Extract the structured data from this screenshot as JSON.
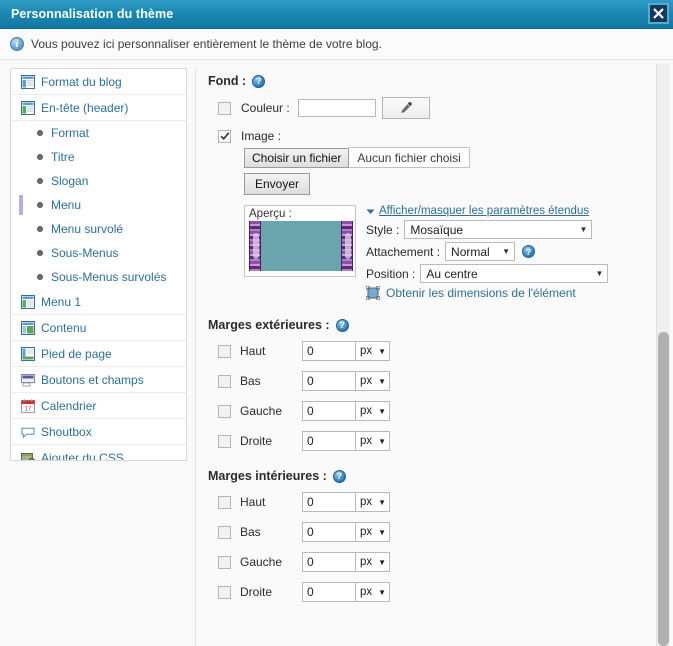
{
  "window": {
    "title": "Personnalisation du thème",
    "close_label": "×"
  },
  "info": {
    "icon": "info-icon",
    "message": "Vous pouvez ici personnaliser entièrement le thème de votre blog."
  },
  "sidebar": {
    "items": [
      {
        "label": "Format du blog",
        "icon": "layout-icon",
        "type": "top"
      },
      {
        "label": "En-tête (header)",
        "icon": "layout-icon",
        "type": "top"
      },
      {
        "label": "Format",
        "icon": "bullet-icon",
        "type": "sub",
        "selected": false
      },
      {
        "label": "Titre",
        "icon": "bullet-icon",
        "type": "sub",
        "selected": false
      },
      {
        "label": "Slogan",
        "icon": "bullet-icon",
        "type": "sub",
        "selected": false
      },
      {
        "label": "Menu",
        "icon": "bullet-icon",
        "type": "sub",
        "selected": true
      },
      {
        "label": "Menu survolé",
        "icon": "bullet-icon",
        "type": "sub",
        "selected": false
      },
      {
        "label": "Sous-Menus",
        "icon": "bullet-icon",
        "type": "sub",
        "selected": false
      },
      {
        "label": "Sous-Menus survolés",
        "icon": "bullet-icon",
        "type": "sub",
        "selected": false
      },
      {
        "label": "Menu 1",
        "icon": "layout-icon",
        "type": "top"
      },
      {
        "label": "Contenu",
        "icon": "layout-icon",
        "type": "top"
      },
      {
        "label": "Pied de page",
        "icon": "layout-icon",
        "type": "top"
      },
      {
        "label": "Boutons et champs",
        "icon": "button-icon",
        "type": "top"
      },
      {
        "label": "Calendrier",
        "icon": "calendar-icon",
        "type": "top"
      },
      {
        "label": "Shoutbox",
        "icon": "speech-bubble-icon",
        "type": "top"
      },
      {
        "label": "Ajouter du CSS",
        "icon": "css-add-icon",
        "type": "top"
      }
    ]
  },
  "background": {
    "section_title": "Fond :",
    "help_label": "?",
    "color": {
      "checked": false,
      "label": "Couleur :",
      "value": "",
      "picker_icon": "eyedropper-icon"
    },
    "image": {
      "checked": true,
      "label": "Image :",
      "choose_button": "Choisir un fichier",
      "file_status": "Aucun fichier choisi",
      "send_button": "Envoyer"
    },
    "preview": {
      "label": "Aperçu :"
    },
    "extended": {
      "toggle_label": "Afficher/masquer les paramètres étendus",
      "toggle_icon": "chevron-down-icon",
      "style_label": "Style :",
      "style_value": "Mosaïque",
      "attachment_label": "Attachement :",
      "attachment_value": "Normal",
      "position_label": "Position :",
      "position_value": "Au centre",
      "dimensions_label": "Obtenir les dimensions de l'élément",
      "dimensions_icon": "resize-square-icon"
    }
  },
  "outer_margins": {
    "title": "Marges extérieures :",
    "rows": [
      {
        "label": "Haut",
        "checked": false,
        "value": "0",
        "unit": "px"
      },
      {
        "label": "Bas",
        "checked": false,
        "value": "0",
        "unit": "px"
      },
      {
        "label": "Gauche",
        "checked": false,
        "value": "0",
        "unit": "px"
      },
      {
        "label": "Droite",
        "checked": false,
        "value": "0",
        "unit": "px"
      }
    ]
  },
  "inner_margins": {
    "title": "Marges intérieures :",
    "rows": [
      {
        "label": "Haut",
        "checked": false,
        "value": "0",
        "unit": "px"
      },
      {
        "label": "Bas",
        "checked": false,
        "value": "0",
        "unit": "px"
      },
      {
        "label": "Gauche",
        "checked": false,
        "value": "0",
        "unit": "px"
      },
      {
        "label": "Droite",
        "checked": false,
        "value": "0",
        "unit": "px"
      }
    ]
  },
  "colors": {
    "titlebar": "#1b86b0",
    "link": "#2f6f94",
    "selected_marker": "#b9aee0",
    "preview_bg": "#6aa5ad",
    "preview_ornament": "#8e4fa8"
  }
}
